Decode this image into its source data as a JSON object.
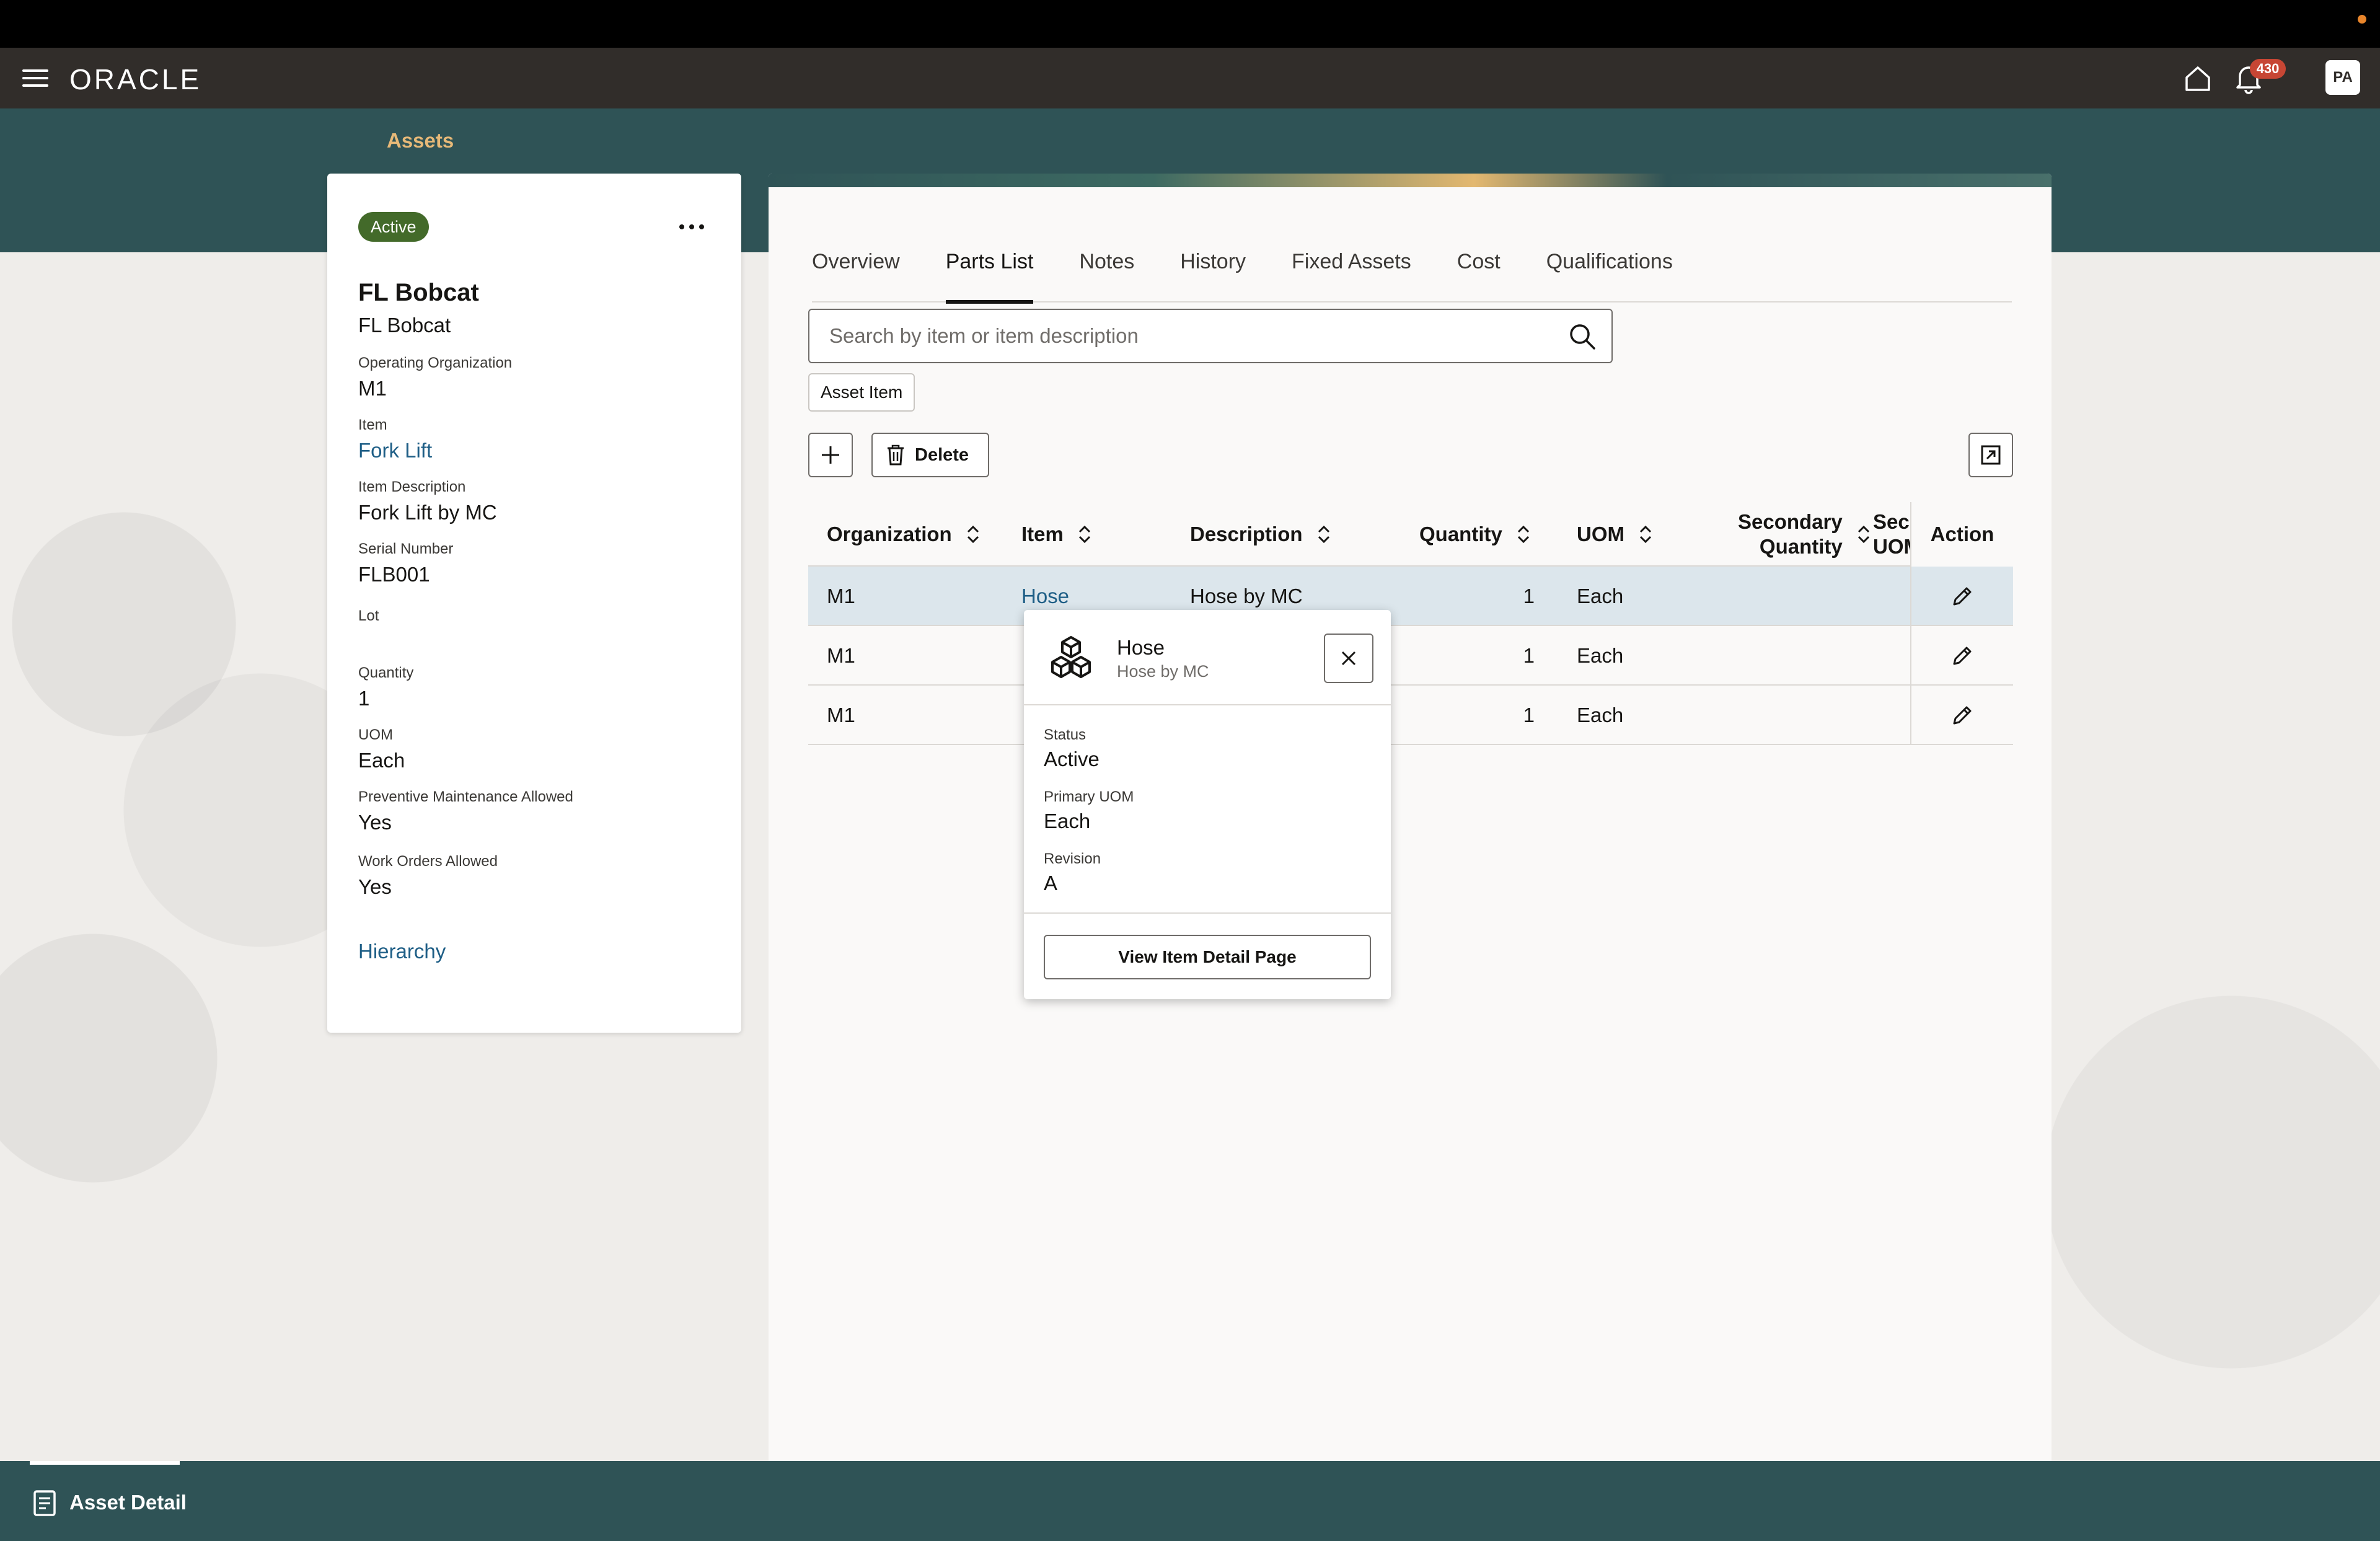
{
  "header": {
    "logo": "ORACLE",
    "notification_count": "430",
    "avatar_initials": "PA"
  },
  "breadcrumb": "Assets",
  "asset": {
    "status": "Active",
    "name": "FL Bobcat",
    "subtitle": "FL Bobcat",
    "fields": [
      {
        "label": "Operating Organization",
        "value": "M1"
      },
      {
        "label": "Item",
        "value": "Fork Lift"
      },
      {
        "label": "Item Description",
        "value": "Fork Lift by MC"
      },
      {
        "label": "Serial Number",
        "value": "FLB001"
      },
      {
        "label": "Lot",
        "value": ""
      },
      {
        "label": "Quantity",
        "value": "1"
      },
      {
        "label": "UOM",
        "value": "Each"
      },
      {
        "label": "Preventive Maintenance Allowed",
        "value": "Yes"
      },
      {
        "label": "Work Orders Allowed",
        "value": "Yes"
      }
    ],
    "hierarchy_link": "Hierarchy"
  },
  "tabs": [
    {
      "label": "Overview"
    },
    {
      "label": "Parts List"
    },
    {
      "label": "Notes"
    },
    {
      "label": "History"
    },
    {
      "label": "Fixed Assets"
    },
    {
      "label": "Cost"
    },
    {
      "label": "Qualifications"
    }
  ],
  "selected_tab": "Parts List",
  "search": {
    "placeholder": "Search by item or item description"
  },
  "filter_chip": "Asset Item",
  "toolbar": {
    "delete_label": "Delete"
  },
  "table": {
    "columns": {
      "organization": "Organization",
      "item": "Item",
      "description": "Description",
      "quantity": "Quantity",
      "uom": "UOM",
      "secondary_quantity_1": "Secondary",
      "secondary_quantity_2": "Quantity",
      "secondary_uom_1": "Seco",
      "secondary_uom_2": "UOM",
      "action": "Action"
    },
    "rows": [
      {
        "organization": "M1",
        "item": "Hose",
        "description": "Hose by MC",
        "quantity": "1",
        "uom": "Each",
        "secondary_quantity": ""
      },
      {
        "organization": "M1",
        "item": "",
        "description": "",
        "quantity": "1",
        "uom": "Each",
        "secondary_quantity": ""
      },
      {
        "organization": "M1",
        "item": "",
        "description": "",
        "quantity": "1",
        "uom": "Each",
        "secondary_quantity": ""
      }
    ]
  },
  "popup": {
    "title": "Hose",
    "subtitle": "Hose by MC",
    "fields": [
      {
        "label": "Status",
        "value": "Active"
      },
      {
        "label": "Primary UOM",
        "value": "Each"
      },
      {
        "label": "Revision",
        "value": "A"
      }
    ],
    "button_label": "View Item Detail Page"
  },
  "footer": {
    "tab_label": "Asset Detail"
  },
  "colors": {
    "header_bg": "#312d2a",
    "band_bg": "#2f5356",
    "active_badge": "#436a2a",
    "link": "#1e5e86",
    "breadcrumb": "#e7b978",
    "notification_badge": "#c74634",
    "selected_row": "#dce6ec"
  }
}
